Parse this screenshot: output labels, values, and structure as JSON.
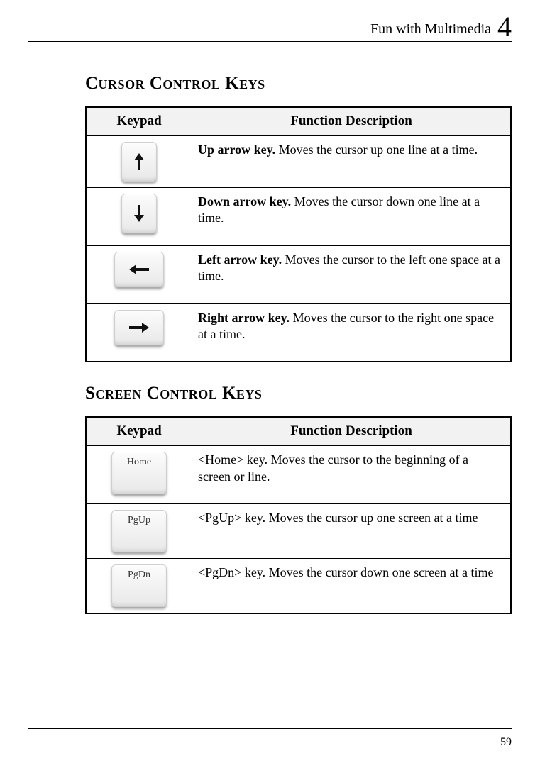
{
  "header": {
    "running_title": "Fun with Multimedia",
    "chapter_number": "4"
  },
  "sections": {
    "cursor": {
      "title": "Cursor Control Keys",
      "col1": "Keypad",
      "col2": "Function Description",
      "rows": [
        {
          "key_name": "up-arrow",
          "bold": "Up arrow key.",
          "rest": " Moves the cursor up one line at a time."
        },
        {
          "key_name": "down-arrow",
          "bold": "Down arrow key.",
          "rest": " Moves the cursor down one line at a time."
        },
        {
          "key_name": "left-arrow",
          "bold": "Left arrow key.",
          "rest": " Moves the cursor to the left one space at a time."
        },
        {
          "key_name": "right-arrow",
          "bold": "Right arrow key.",
          "rest": " Moves the cursor to the right one space at a time."
        }
      ]
    },
    "screen": {
      "title": "Screen Control Keys",
      "col1": "Keypad",
      "col2": "Function Description",
      "rows": [
        {
          "key_name": "home",
          "key_label": "Home",
          "text": "<Home> key. Moves the cursor to the beginning of a screen or line."
        },
        {
          "key_name": "pgup",
          "key_label": "PgUp",
          "text": "<PgUp> key. Moves the cursor up one screen at a time"
        },
        {
          "key_name": "pgdn",
          "key_label": "PgDn",
          "text": "<PgDn> key. Moves the cursor down one screen at a time"
        }
      ]
    }
  },
  "page_number": "59"
}
